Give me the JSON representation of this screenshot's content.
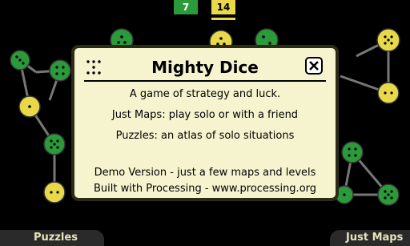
{
  "scores": {
    "green": "7",
    "yellow": "14"
  },
  "colors": {
    "green": "#2a9a3a",
    "yellow": "#e8d84a",
    "panel": "#f6f3cf"
  },
  "dialog": {
    "title": "Mighty Dice",
    "icon": "dice-icon",
    "close_icon": "close-icon",
    "lines": [
      "A game of strategy and luck.",
      "Just Maps: play solo or with a friend",
      "Puzzles: an atlas of solo situations",
      "Demo Version - just a few maps and levels",
      "Built with Processing - www.processing.org"
    ]
  },
  "tabs": {
    "left": "Puzzles",
    "right": "Just Maps"
  }
}
